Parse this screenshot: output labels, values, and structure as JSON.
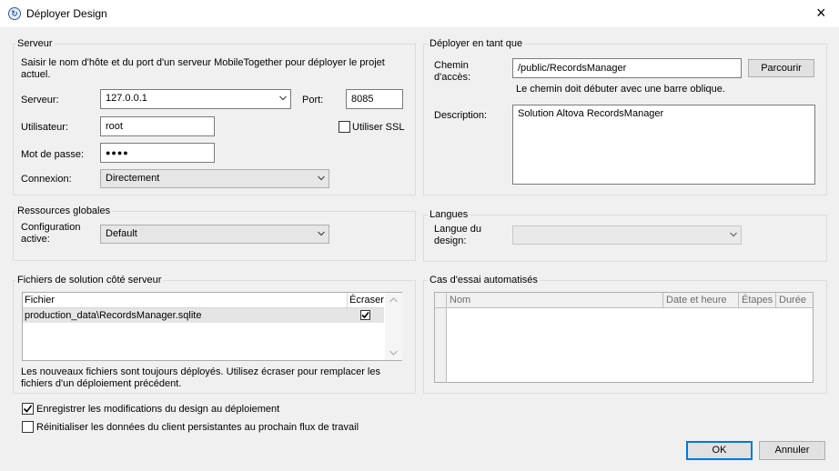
{
  "window": {
    "title": "Déployer Design",
    "icon": "deploy-icon",
    "close": "×"
  },
  "server": {
    "group_label": "Serveur",
    "description": "Saisir le nom d'hôte et du port d'un serveur MobileTogether pour déployer le projet actuel.",
    "server_label": "Serveur:",
    "server_value": "127.0.0.1",
    "port_label": "Port:",
    "port_value": "8085",
    "user_label": "Utilisateur:",
    "user_value": "root",
    "ssl_label": "Utiliser SSL",
    "ssl_checked": false,
    "password_label": "Mot de passe:",
    "password_value": "●●●●",
    "connection_label": "Connexion:",
    "connection_value": "Directement"
  },
  "deploy_as": {
    "group_label": "Déployer en tant que",
    "path_label": "Chemin d'accès:",
    "path_value": "/public/RecordsManager",
    "browse_button": "Parcourir",
    "path_hint": "Le chemin doit débuter avec une barre oblique.",
    "description_label": "Description:",
    "description_value": "Solution Altova RecordsManager"
  },
  "global_resources": {
    "group_label": "Ressources globales",
    "config_label": "Configuration active:",
    "config_value": "Default"
  },
  "languages": {
    "group_label": "Langues",
    "design_lang_label": "Langue du design:",
    "design_lang_value": ""
  },
  "server_files": {
    "group_label": "Fichiers de solution côté serveur",
    "col_file": "Fichier",
    "col_overwrite": "Écraser",
    "rows": [
      {
        "file": "production_data\\RecordsManager.sqlite",
        "overwrite": true
      }
    ],
    "note": "Les nouveaux fichiers sont toujours déployés. Utilisez écraser pour remplacer les fichiers d'un déploiement précédent."
  },
  "test_cases": {
    "group_label": "Cas d'essai automatisés",
    "columns": [
      "Nom",
      "Date et heure",
      "Étapes",
      "Durée"
    ]
  },
  "options": {
    "save_changes_label": "Enregistrer les modifications du design au déploiement",
    "save_changes_checked": true,
    "reset_data_label": "Réinitialiser les données du client persistantes au prochain flux de travail",
    "reset_data_checked": false
  },
  "footer": {
    "ok_button": "OK",
    "cancel_button": "Annuler"
  }
}
